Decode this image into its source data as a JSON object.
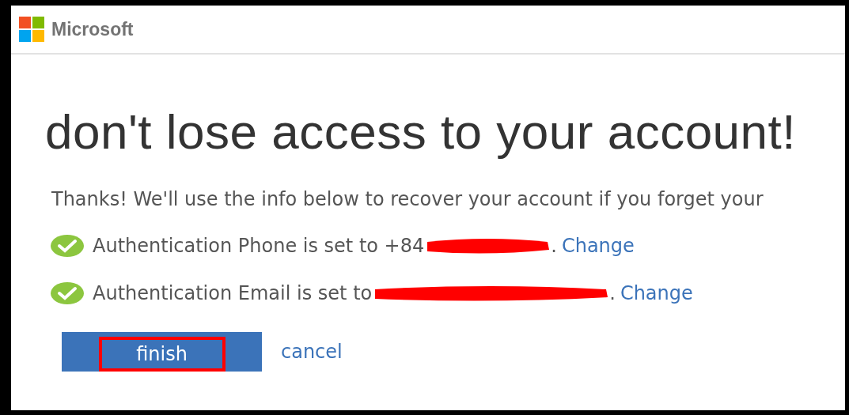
{
  "header": {
    "brand": "Microsoft"
  },
  "title": "don't lose access to your account!",
  "intro": "Thanks! We'll use the info below to recover your account if you forget your",
  "methods": [
    {
      "label": "Authentication Phone is set to +84",
      "verified": true,
      "suffix": ".",
      "link": "Change"
    },
    {
      "label": "Authentication Email is set to",
      "verified": true,
      "suffix": ".",
      "link": "Change"
    }
  ],
  "buttons": {
    "primary": "finish",
    "secondary": "cancel"
  }
}
